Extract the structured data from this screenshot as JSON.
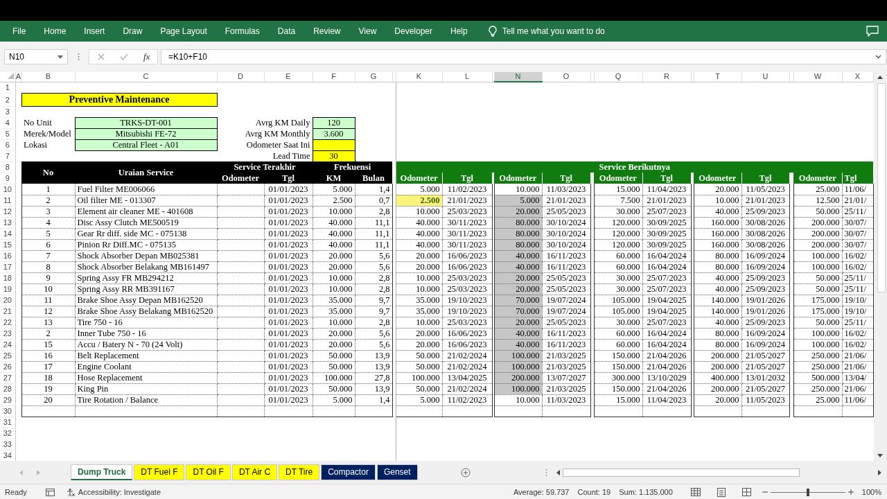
{
  "ribbon": {
    "tabs": [
      "File",
      "Home",
      "Insert",
      "Draw",
      "Page Layout",
      "Formulas",
      "Data",
      "Review",
      "View",
      "Developer",
      "Help"
    ],
    "tell_me": "Tell me what you want to do"
  },
  "formula_bar": {
    "name_box": "N10",
    "fx": "fx",
    "formula": "=K10+F10"
  },
  "columns": [
    {
      "label": "A",
      "selected": false
    },
    {
      "label": "B",
      "selected": false
    },
    {
      "label": "C",
      "selected": false
    },
    {
      "label": "D",
      "selected": false
    },
    {
      "label": "E",
      "selected": false
    },
    {
      "label": "F",
      "selected": false
    },
    {
      "label": "G",
      "selected": false
    },
    {
      "label": "K",
      "selected": false
    },
    {
      "label": "L",
      "selected": false
    },
    {
      "label": "N",
      "selected": true
    },
    {
      "label": "O",
      "selected": false
    },
    {
      "label": "Q",
      "selected": false
    },
    {
      "label": "R",
      "selected": false
    },
    {
      "label": "T",
      "selected": false
    },
    {
      "label": "U",
      "selected": false
    },
    {
      "label": "W",
      "selected": false
    },
    {
      "label": "X",
      "selected": false
    }
  ],
  "row_numbers": [
    "1",
    "2",
    "3",
    "4",
    "5",
    "6",
    "7",
    "8",
    "9",
    "10",
    "11",
    "12",
    "13",
    "14",
    "15",
    "16",
    "17",
    "18",
    "19",
    "20",
    "21",
    "22",
    "23",
    "24",
    "25",
    "26",
    "27",
    "28",
    "29",
    "30",
    "31",
    "32",
    "33",
    "34"
  ],
  "sheet": {
    "title": "Preventive Maintenance",
    "info": [
      {
        "label": "No Unit",
        "value": "TRKS-DT-001"
      },
      {
        "label": "Merek/Model",
        "value": "Mitsubishi FE-72"
      },
      {
        "label": "Lokasi",
        "value": "Central Fleet - A01"
      }
    ],
    "stats": [
      {
        "label": "Avrg KM Daily",
        "value": "120",
        "kind": "computed"
      },
      {
        "label": "Avrg KM Monthly",
        "value": "3.600",
        "kind": "computed"
      },
      {
        "label": "Odometer Saat Ini",
        "kind": "input"
      },
      {
        "label": "Lead Time",
        "value": "30",
        "kind": "input"
      }
    ],
    "headers": {
      "no": "No",
      "service": "Uraian Service",
      "last": "Service Terakhir",
      "last_cols": [
        "Odometer",
        "Tgl"
      ],
      "freq": "Frekuensi",
      "freq_cols": [
        "KM",
        "Bulan"
      ],
      "next": "Service Berikutnya",
      "next_cols": [
        {
          "odometer": "Odometer",
          "tgl": "Tgl"
        },
        {
          "odometer": "Odometer",
          "tgl": "Tgl"
        },
        {
          "odometer": "Odometer",
          "tgl": "Tgl"
        },
        {
          "odometer": "Odometer",
          "tgl": "Tgl"
        },
        {
          "odometer": "Odometer",
          "tgl": "Tgl"
        }
      ]
    },
    "rows": [
      {
        "no": "1",
        "service": "Fuel Filter ME006066",
        "tgl": "01/01/2023",
        "km": "5.000",
        "bulan": "1,4",
        "next": [
          {
            "odometer": "5.000",
            "tgl": "11/02/2023",
            "selected": false,
            "highlight": false
          },
          {
            "odometer": "10.000",
            "tgl": "11/03/2023",
            "selected": false,
            "highlight": false
          },
          {
            "odometer": "15.000",
            "tgl": "11/04/2023",
            "selected": false,
            "highlight": false
          },
          {
            "odometer": "20.000",
            "tgl": "11/05/2023",
            "selected": false,
            "highlight": false
          },
          {
            "odometer": "25.000",
            "tgl": "11/06/",
            "selected": false,
            "highlight": false
          }
        ]
      },
      {
        "no": "2",
        "service": "Oil filter ME - 013307",
        "tgl": "01/01/2023",
        "km": "2.500",
        "bulan": "0,7",
        "next": [
          {
            "odometer": "2.500",
            "tgl": "21/01/2023",
            "selected": false,
            "highlight": true
          },
          {
            "odometer": "5.000",
            "tgl": "21/01/2023",
            "selected": true,
            "highlight": false
          },
          {
            "odometer": "7.500",
            "tgl": "21/01/2023",
            "selected": false,
            "highlight": false
          },
          {
            "odometer": "10.000",
            "tgl": "21/01/2023",
            "selected": false,
            "highlight": false
          },
          {
            "odometer": "12.500",
            "tgl": "21/01/",
            "selected": false,
            "highlight": false
          }
        ]
      },
      {
        "no": "3",
        "service": "Element air cleaner ME - 401608",
        "tgl": "01/01/2023",
        "km": "10.000",
        "bulan": "2,8",
        "next": [
          {
            "odometer": "10.000",
            "tgl": "25/03/2023",
            "selected": false,
            "highlight": false
          },
          {
            "odometer": "20.000",
            "tgl": "25/05/2023",
            "selected": true,
            "highlight": false
          },
          {
            "odometer": "30.000",
            "tgl": "25/07/2023",
            "selected": false,
            "highlight": false
          },
          {
            "odometer": "40.000",
            "tgl": "25/09/2023",
            "selected": false,
            "highlight": false
          },
          {
            "odometer": "50.000",
            "tgl": "25/11/",
            "selected": false,
            "highlight": false
          }
        ]
      },
      {
        "no": "4",
        "service": "Disc Assy Clutch ME500519",
        "tgl": "01/01/2023",
        "km": "40.000",
        "bulan": "11,1",
        "next": [
          {
            "odometer": "40.000",
            "tgl": "30/11/2023",
            "selected": false,
            "highlight": false
          },
          {
            "odometer": "80.000",
            "tgl": "30/10/2024",
            "selected": true,
            "highlight": false
          },
          {
            "odometer": "120.000",
            "tgl": "30/09/2025",
            "selected": false,
            "highlight": false
          },
          {
            "odometer": "160.000",
            "tgl": "30/08/2026",
            "selected": false,
            "highlight": false
          },
          {
            "odometer": "200.000",
            "tgl": "30/07/",
            "selected": false,
            "highlight": false
          }
        ]
      },
      {
        "no": "5",
        "service": "Gear Rr diff. side MC - 075138",
        "tgl": "01/01/2023",
        "km": "40.000",
        "bulan": "11,1",
        "next": [
          {
            "odometer": "40.000",
            "tgl": "30/11/2023",
            "selected": false,
            "highlight": false
          },
          {
            "odometer": "80.000",
            "tgl": "30/10/2024",
            "selected": true,
            "highlight": false
          },
          {
            "odometer": "120.000",
            "tgl": "30/09/2025",
            "selected": false,
            "highlight": false
          },
          {
            "odometer": "160.000",
            "tgl": "30/08/2026",
            "selected": false,
            "highlight": false
          },
          {
            "odometer": "200.000",
            "tgl": "30/07/",
            "selected": false,
            "highlight": false
          }
        ]
      },
      {
        "no": "6",
        "service": "Pinion Rr Diff.MC - 075135",
        "tgl": "01/01/2023",
        "km": "40.000",
        "bulan": "11,1",
        "next": [
          {
            "odometer": "40.000",
            "tgl": "30/11/2023",
            "selected": false,
            "highlight": false
          },
          {
            "odometer": "80.000",
            "tgl": "30/10/2024",
            "selected": true,
            "highlight": false
          },
          {
            "odometer": "120.000",
            "tgl": "30/09/2025",
            "selected": false,
            "highlight": false
          },
          {
            "odometer": "160.000",
            "tgl": "30/08/2026",
            "selected": false,
            "highlight": false
          },
          {
            "odometer": "200.000",
            "tgl": "30/07/",
            "selected": false,
            "highlight": false
          }
        ]
      },
      {
        "no": "7",
        "service": "Shock Absorber Depan MB025381",
        "tgl": "01/01/2023",
        "km": "20.000",
        "bulan": "5,6",
        "next": [
          {
            "odometer": "20.000",
            "tgl": "16/06/2023",
            "selected": false,
            "highlight": false
          },
          {
            "odometer": "40.000",
            "tgl": "16/11/2023",
            "selected": true,
            "highlight": false
          },
          {
            "odometer": "60.000",
            "tgl": "16/04/2024",
            "selected": false,
            "highlight": false
          },
          {
            "odometer": "80.000",
            "tgl": "16/09/2024",
            "selected": false,
            "highlight": false
          },
          {
            "odometer": "100.000",
            "tgl": "16/02/",
            "selected": false,
            "highlight": false
          }
        ]
      },
      {
        "no": "8",
        "service": "Shock Absorber Belakang MB161497",
        "tgl": "01/01/2023",
        "km": "20.000",
        "bulan": "5,6",
        "next": [
          {
            "odometer": "20.000",
            "tgl": "16/06/2023",
            "selected": false,
            "highlight": false
          },
          {
            "odometer": "40.000",
            "tgl": "16/11/2023",
            "selected": true,
            "highlight": false
          },
          {
            "odometer": "60.000",
            "tgl": "16/04/2024",
            "selected": false,
            "highlight": false
          },
          {
            "odometer": "80.000",
            "tgl": "16/09/2024",
            "selected": false,
            "highlight": false
          },
          {
            "odometer": "100.000",
            "tgl": "16/02/",
            "selected": false,
            "highlight": false
          }
        ]
      },
      {
        "no": "9",
        "service": "Spring Assy FR MB294212",
        "tgl": "01/01/2023",
        "km": "10.000",
        "bulan": "2,8",
        "next": [
          {
            "odometer": "10.000",
            "tgl": "25/03/2023",
            "selected": false,
            "highlight": false
          },
          {
            "odometer": "20.000",
            "tgl": "25/05/2023",
            "selected": true,
            "highlight": false
          },
          {
            "odometer": "30.000",
            "tgl": "25/07/2023",
            "selected": false,
            "highlight": false
          },
          {
            "odometer": "40.000",
            "tgl": "25/09/2023",
            "selected": false,
            "highlight": false
          },
          {
            "odometer": "50.000",
            "tgl": "25/11/",
            "selected": false,
            "highlight": false
          }
        ]
      },
      {
        "no": "10",
        "service": "Spring Assy RR MB391167",
        "tgl": "01/01/2023",
        "km": "10.000",
        "bulan": "2,8",
        "next": [
          {
            "odometer": "10.000",
            "tgl": "25/03/2023",
            "selected": false,
            "highlight": false
          },
          {
            "odometer": "20.000",
            "tgl": "25/05/2023",
            "selected": true,
            "highlight": false
          },
          {
            "odometer": "30.000",
            "tgl": "25/07/2023",
            "selected": false,
            "highlight": false
          },
          {
            "odometer": "40.000",
            "tgl": "25/09/2023",
            "selected": false,
            "highlight": false
          },
          {
            "odometer": "50.000",
            "tgl": "25/11/",
            "selected": false,
            "highlight": false
          }
        ]
      },
      {
        "no": "11",
        "service": "Brake Shoe Assy Depan MB162520",
        "tgl": "01/01/2023",
        "km": "35.000",
        "bulan": "9,7",
        "next": [
          {
            "odometer": "35.000",
            "tgl": "19/10/2023",
            "selected": false,
            "highlight": false
          },
          {
            "odometer": "70.000",
            "tgl": "19/07/2024",
            "selected": true,
            "highlight": false
          },
          {
            "odometer": "105.000",
            "tgl": "19/04/2025",
            "selected": false,
            "highlight": false
          },
          {
            "odometer": "140.000",
            "tgl": "19/01/2026",
            "selected": false,
            "highlight": false
          },
          {
            "odometer": "175.000",
            "tgl": "19/10/",
            "selected": false,
            "highlight": false
          }
        ]
      },
      {
        "no": "12",
        "service": "Brake Shoe Assy Belakang MB162520",
        "tgl": "01/01/2023",
        "km": "35.000",
        "bulan": "9,7",
        "next": [
          {
            "odometer": "35.000",
            "tgl": "19/10/2023",
            "selected": false,
            "highlight": false
          },
          {
            "odometer": "70.000",
            "tgl": "19/07/2024",
            "selected": true,
            "highlight": false
          },
          {
            "odometer": "105.000",
            "tgl": "19/04/2025",
            "selected": false,
            "highlight": false
          },
          {
            "odometer": "140.000",
            "tgl": "19/01/2026",
            "selected": false,
            "highlight": false
          },
          {
            "odometer": "175.000",
            "tgl": "19/10/",
            "selected": false,
            "highlight": false
          }
        ]
      },
      {
        "no": "13",
        "service": "Tire 750 - 16",
        "tgl": "01/01/2023",
        "km": "10.000",
        "bulan": "2,8",
        "next": [
          {
            "odometer": "10.000",
            "tgl": "25/03/2023",
            "selected": false,
            "highlight": false
          },
          {
            "odometer": "20.000",
            "tgl": "25/05/2023",
            "selected": true,
            "highlight": false
          },
          {
            "odometer": "30.000",
            "tgl": "25/07/2023",
            "selected": false,
            "highlight": false
          },
          {
            "odometer": "40.000",
            "tgl": "25/09/2023",
            "selected": false,
            "highlight": false
          },
          {
            "odometer": "50.000",
            "tgl": "25/11/",
            "selected": false,
            "highlight": false
          }
        ]
      },
      {
        "no": "2",
        "service": "Inner Tube 750 - 16",
        "tgl": "01/01/2023",
        "km": "20.000",
        "bulan": "5,6",
        "next": [
          {
            "odometer": "20.000",
            "tgl": "16/06/2023",
            "selected": false,
            "highlight": false
          },
          {
            "odometer": "40.000",
            "tgl": "16/11/2023",
            "selected": true,
            "highlight": false
          },
          {
            "odometer": "60.000",
            "tgl": "16/04/2024",
            "selected": false,
            "highlight": false
          },
          {
            "odometer": "80.000",
            "tgl": "16/09/2024",
            "selected": false,
            "highlight": false
          },
          {
            "odometer": "100.000",
            "tgl": "16/02/",
            "selected": false,
            "highlight": false
          }
        ]
      },
      {
        "no": "15",
        "service": "Accu / Batery N - 70 (24 Volt)",
        "tgl": "01/01/2023",
        "km": "20.000",
        "bulan": "5,6",
        "next": [
          {
            "odometer": "20.000",
            "tgl": "16/06/2023",
            "selected": false,
            "highlight": false
          },
          {
            "odometer": "40.000",
            "tgl": "16/11/2023",
            "selected": true,
            "highlight": false
          },
          {
            "odometer": "60.000",
            "tgl": "16/04/2024",
            "selected": false,
            "highlight": false
          },
          {
            "odometer": "80.000",
            "tgl": "16/09/2024",
            "selected": false,
            "highlight": false
          },
          {
            "odometer": "100.000",
            "tgl": "16/02/",
            "selected": false,
            "highlight": false
          }
        ]
      },
      {
        "no": "16",
        "service": "Belt Replacement",
        "tgl": "01/01/2023",
        "km": "50.000",
        "bulan": "13,9",
        "next": [
          {
            "odometer": "50.000",
            "tgl": "21/02/2024",
            "selected": false,
            "highlight": false
          },
          {
            "odometer": "100.000",
            "tgl": "21/03/2025",
            "selected": true,
            "highlight": false
          },
          {
            "odometer": "150.000",
            "tgl": "21/04/2026",
            "selected": false,
            "highlight": false
          },
          {
            "odometer": "200.000",
            "tgl": "21/05/2027",
            "selected": false,
            "highlight": false
          },
          {
            "odometer": "250.000",
            "tgl": "21/06/",
            "selected": false,
            "highlight": false
          }
        ]
      },
      {
        "no": "17",
        "service": "Engine Coolant",
        "tgl": "01/01/2023",
        "km": "50.000",
        "bulan": "13,9",
        "next": [
          {
            "odometer": "50.000",
            "tgl": "21/02/2024",
            "selected": false,
            "highlight": false
          },
          {
            "odometer": "100.000",
            "tgl": "21/03/2025",
            "selected": true,
            "highlight": false
          },
          {
            "odometer": "150.000",
            "tgl": "21/04/2026",
            "selected": false,
            "highlight": false
          },
          {
            "odometer": "200.000",
            "tgl": "21/05/2027",
            "selected": false,
            "highlight": false
          },
          {
            "odometer": "250.000",
            "tgl": "21/06/",
            "selected": false,
            "highlight": false
          }
        ]
      },
      {
        "no": "18",
        "service": "Hose Replacement",
        "tgl": "01/01/2023",
        "km": "100.000",
        "bulan": "27,8",
        "next": [
          {
            "odometer": "100.000",
            "tgl": "13/04/2025",
            "selected": false,
            "highlight": false
          },
          {
            "odometer": "200.000",
            "tgl": "13/07/2027",
            "selected": true,
            "highlight": false
          },
          {
            "odometer": "300.000",
            "tgl": "13/10/2029",
            "selected": false,
            "highlight": false
          },
          {
            "odometer": "400.000",
            "tgl": "13/01/2032",
            "selected": false,
            "highlight": false
          },
          {
            "odometer": "500.000",
            "tgl": "13/04/",
            "selected": false,
            "highlight": false
          }
        ]
      },
      {
        "no": "19",
        "service": "King Pin",
        "tgl": "01/01/2023",
        "km": "50.000",
        "bulan": "13,9",
        "next": [
          {
            "odometer": "50.000",
            "tgl": "21/02/2024",
            "selected": false,
            "highlight": false
          },
          {
            "odometer": "100.000",
            "tgl": "21/03/2025",
            "selected": true,
            "highlight": false
          },
          {
            "odometer": "150.000",
            "tgl": "21/04/2026",
            "selected": false,
            "highlight": false
          },
          {
            "odometer": "200.000",
            "tgl": "21/05/2027",
            "selected": false,
            "highlight": false
          },
          {
            "odometer": "250.000",
            "tgl": "21/06/",
            "selected": false,
            "highlight": false
          }
        ]
      },
      {
        "no": "20",
        "service": "Tire Rotation / Balance",
        "tgl": "01/01/2023",
        "km": "5.000",
        "bulan": "1,4",
        "next": [
          {
            "odometer": "5.000",
            "tgl": "11/02/2023",
            "selected": false,
            "highlight": false
          },
          {
            "odometer": "10.000",
            "tgl": "11/03/2023",
            "selected": false,
            "highlight": false
          },
          {
            "odometer": "15.000",
            "tgl": "11/04/2023",
            "selected": false,
            "highlight": false
          },
          {
            "odometer": "20.000",
            "tgl": "11/05/2023",
            "selected": false,
            "highlight": false
          },
          {
            "odometer": "25.000",
            "tgl": "11/06/",
            "selected": false,
            "highlight": false
          }
        ]
      }
    ]
  },
  "sheet_tabs": [
    {
      "label": "Dump Truck",
      "color": "#ffffff",
      "selected": true
    },
    {
      "label": "DT Fuel F",
      "color": "#ffff00",
      "selected": false
    },
    {
      "label": "DT Oil F",
      "color": "#ffff00",
      "selected": false
    },
    {
      "label": "DT Air C",
      "color": "#ffff00",
      "selected": false
    },
    {
      "label": "DT Tire",
      "color": "#ffff00",
      "selected": false
    },
    {
      "label": "Compactor",
      "color": "#002060",
      "selected": false
    },
    {
      "label": "Genset",
      "color": "#002060",
      "selected": false
    }
  ],
  "status_bar": {
    "mode": "Ready",
    "accessibility": "Accessibility: Investigate",
    "average": "Average: 59.737",
    "count": "Count: 19",
    "sum": "Sum: 1.135.000",
    "zoom": {
      "level": 0.5,
      "label": "100%"
    }
  }
}
